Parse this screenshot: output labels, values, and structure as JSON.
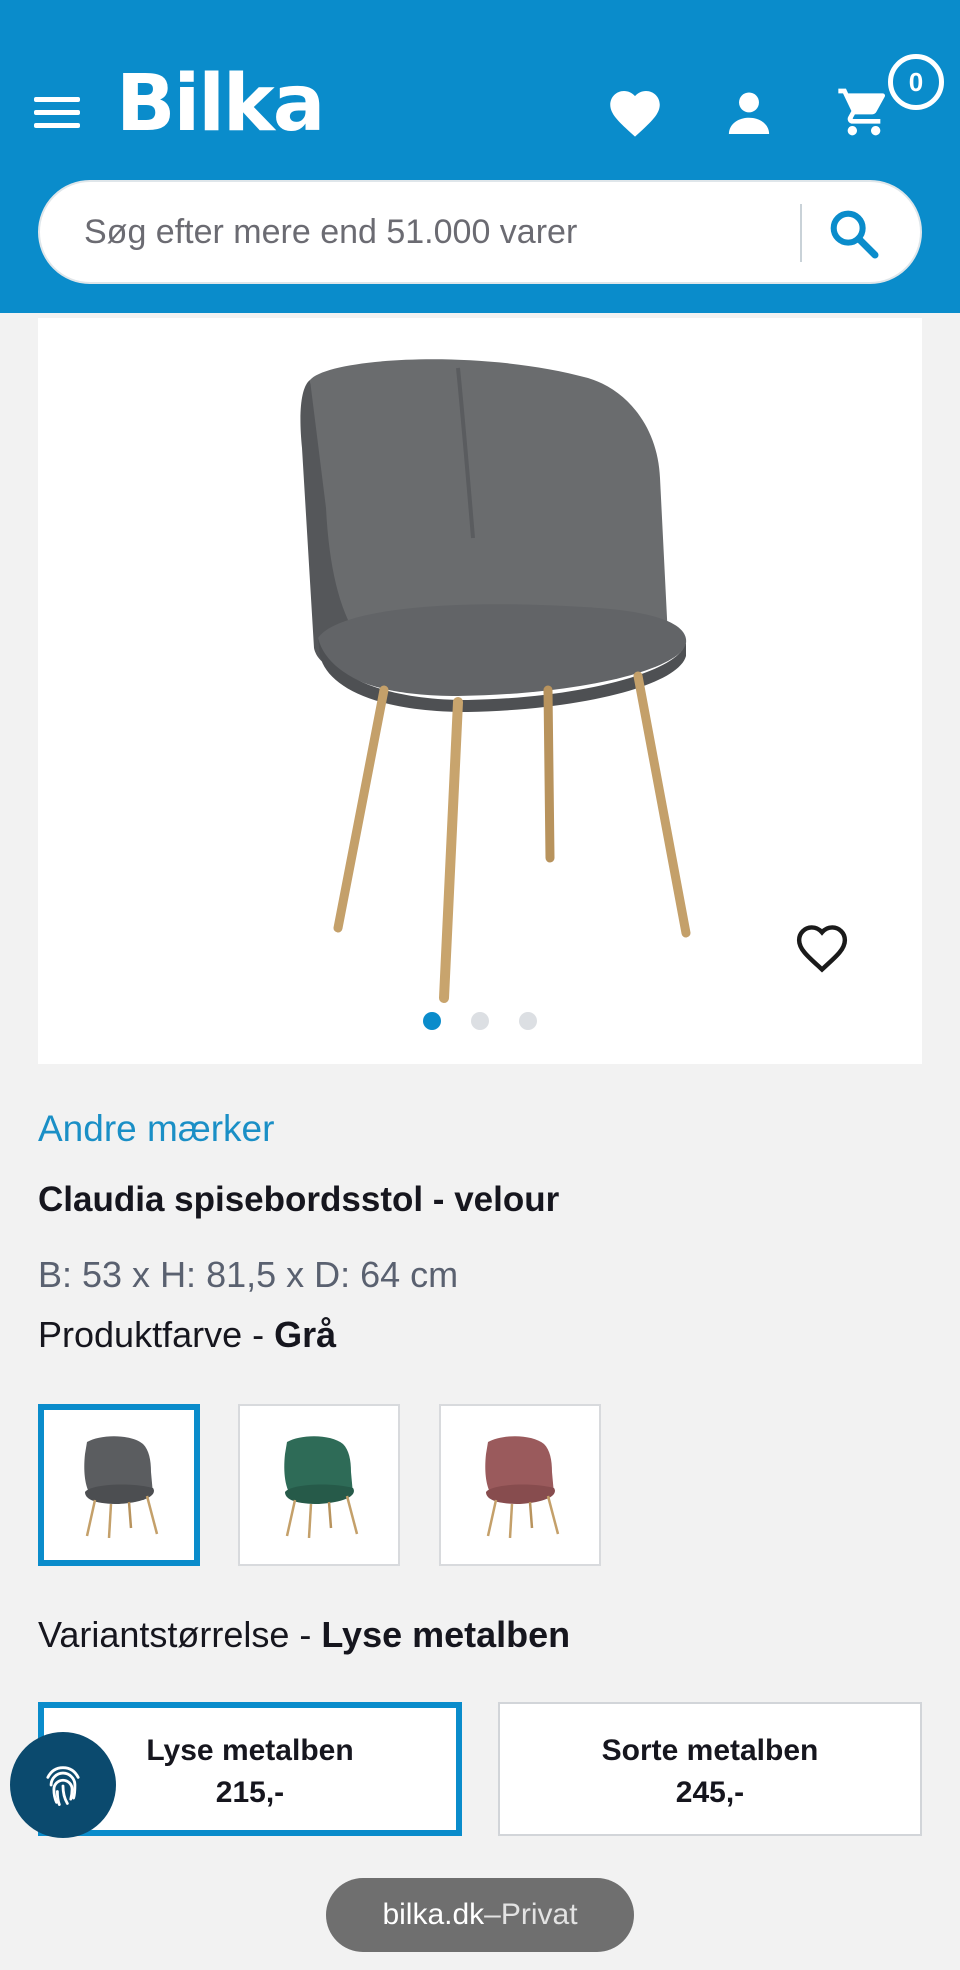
{
  "header": {
    "logo": "Bilka",
    "cart_count": "0"
  },
  "search": {
    "placeholder": "Søg efter mere end 51.000 varer"
  },
  "product": {
    "brand": "Andre mærker",
    "title": "Claudia spisebordsstol - velour",
    "dimensions": "B: 53 x H: 81,5 x D: 64 cm",
    "color_label": "Produktfarve - ",
    "color_value": "Grå",
    "swatches": [
      {
        "name": "Grå",
        "color": "#5b5d60"
      },
      {
        "name": "Grøn",
        "color": "#2e6b57"
      },
      {
        "name": "Rosa",
        "color": "#9a5a5c"
      }
    ],
    "variant_label": "Variantstørrelse - ",
    "variant_value": "Lyse metalben",
    "variants": [
      {
        "label": "Lyse metalben",
        "price": "215,-"
      },
      {
        "label": "Sorte metalben",
        "price": "245,-"
      }
    ]
  },
  "gallery": {
    "image_count": 3,
    "active_index": 0
  },
  "browser": {
    "domain": "bilka.dk",
    "separator": " – ",
    "mode": "Privat"
  },
  "colors": {
    "brand_blue": "#0a8ccb",
    "fingerprint_bg": "#0b4a6e"
  }
}
